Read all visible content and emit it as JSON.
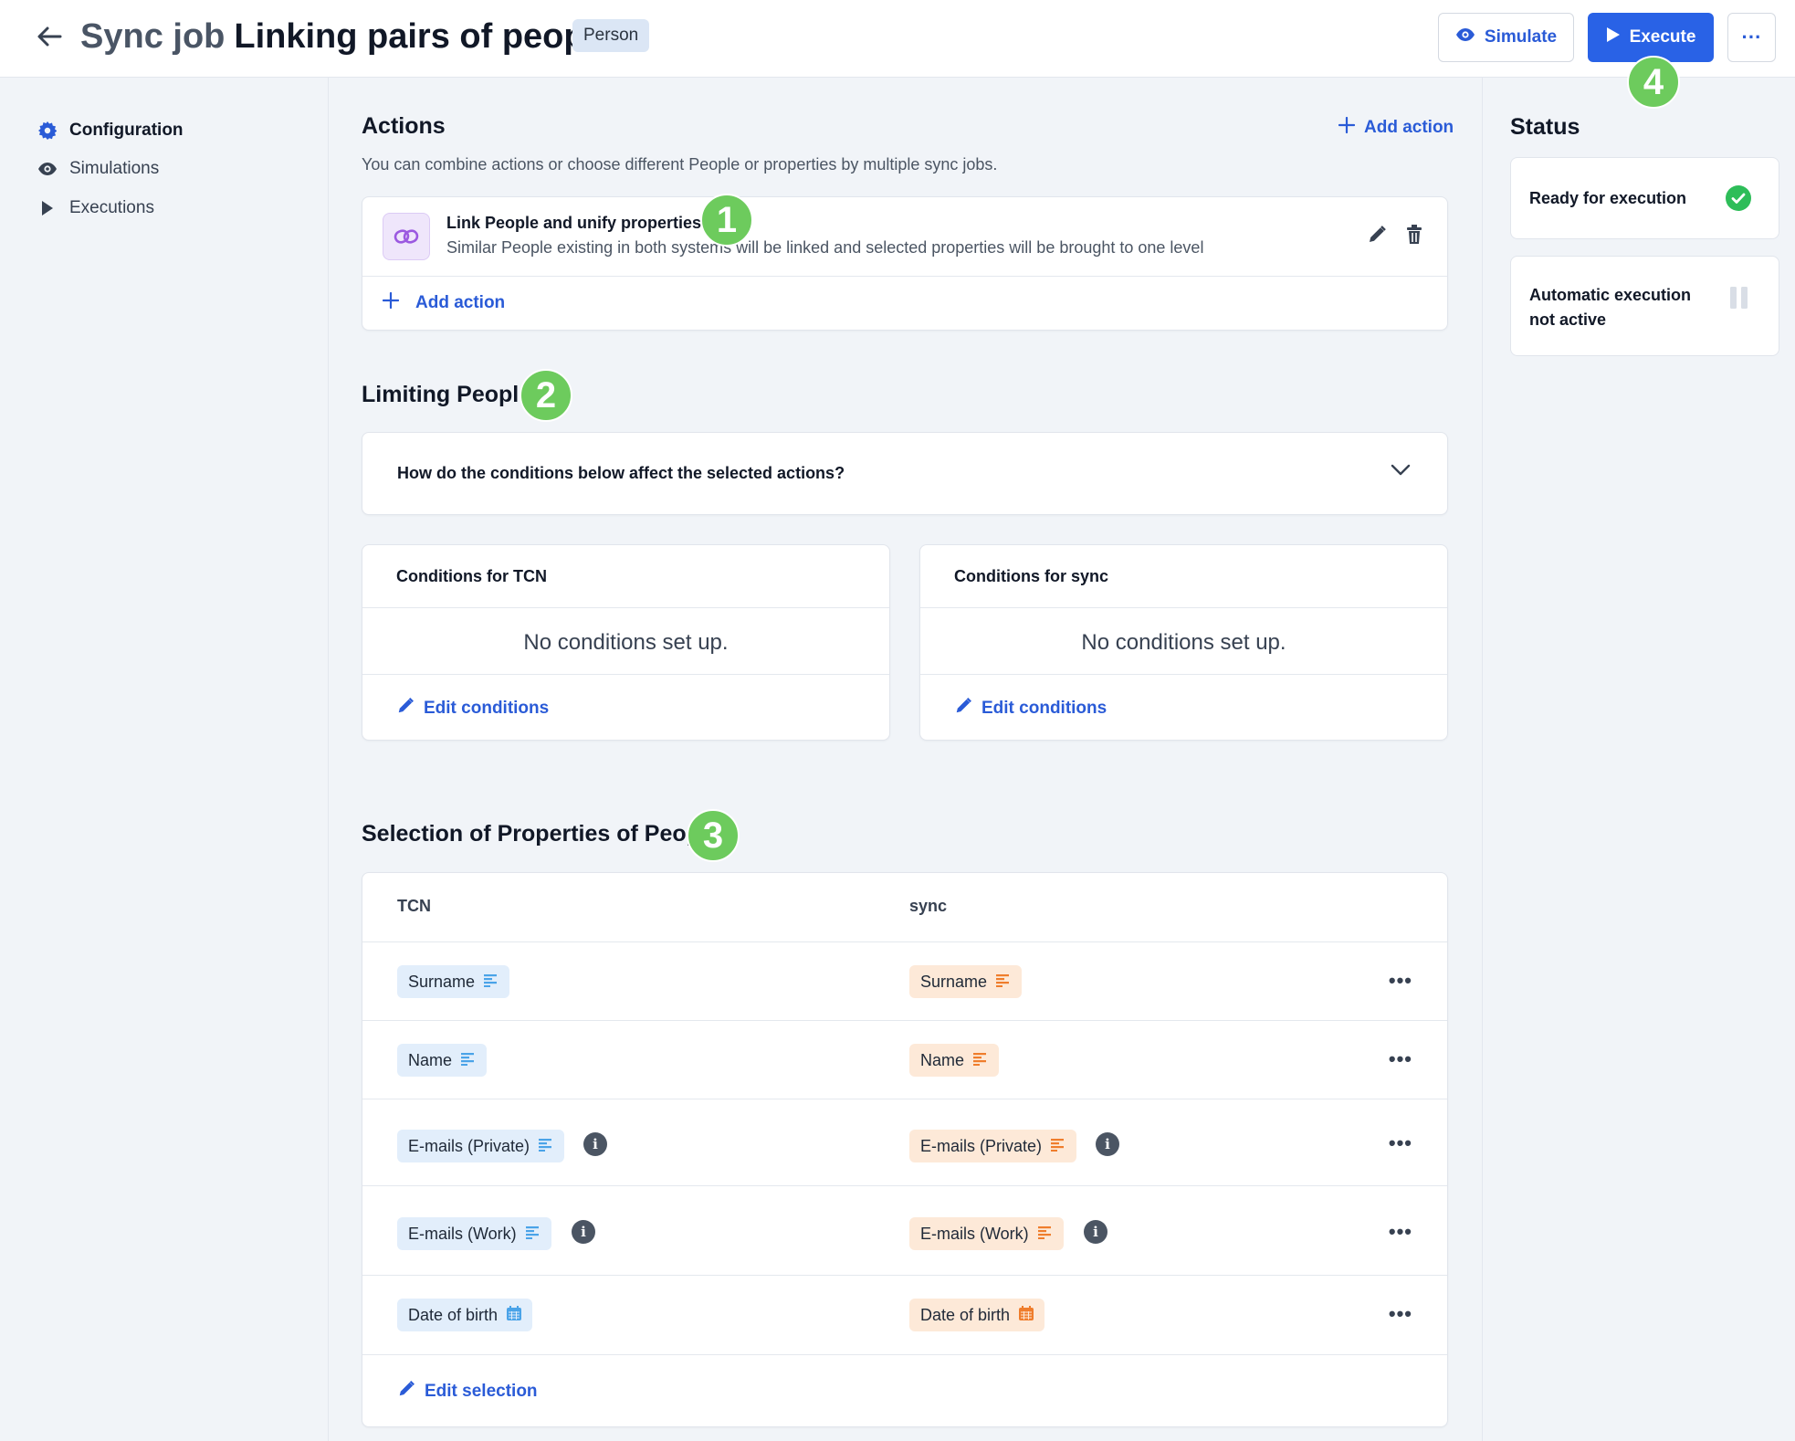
{
  "header": {
    "title_prefix": "Sync job",
    "title": "Linking pairs of people",
    "entity_badge": "Person",
    "simulate_label": "Simulate",
    "execute_label": "Execute",
    "more_label": "···"
  },
  "sidebar": {
    "items": [
      {
        "label": "Configuration",
        "icon": "gear-icon",
        "active": true
      },
      {
        "label": "Simulations",
        "icon": "eye-icon",
        "active": false
      },
      {
        "label": "Executions",
        "icon": "play-icon",
        "active": false
      }
    ]
  },
  "actions": {
    "heading": "Actions",
    "add_action_top": "Add action",
    "description": "You can combine actions or choose different People or properties by multiple sync jobs.",
    "item": {
      "title": "Link People and unify properties",
      "description": "Similar People existing in both systems will be linked and selected properties will be brought to one level",
      "icon": "link-icon"
    },
    "add_action_bottom": "Add action"
  },
  "limiting": {
    "heading": "Limiting People",
    "faq_question": "How do the conditions below affect the selected actions?",
    "tcn": {
      "title": "Conditions for TCN",
      "empty": "No conditions set up.",
      "edit": "Edit conditions"
    },
    "sync": {
      "title": "Conditions for sync",
      "empty": "No conditions set up.",
      "edit": "Edit conditions"
    }
  },
  "selection": {
    "heading": "Selection of Properties of People",
    "col_left": "TCN",
    "col_right": "sync",
    "rows": [
      {
        "left": "Surname",
        "right": "Surname",
        "type": "text",
        "info": false
      },
      {
        "left": "Name",
        "right": "Name",
        "type": "text",
        "info": false
      },
      {
        "left": "E-mails (Private)",
        "right": "E-mails (Private)",
        "type": "text",
        "info": true
      },
      {
        "left": "E-mails (Work)",
        "right": "E-mails (Work)",
        "type": "text",
        "info": true
      },
      {
        "left": "Date of birth",
        "right": "Date of birth",
        "type": "date",
        "info": false
      }
    ],
    "row_more": "•••",
    "edit_selection": "Edit selection"
  },
  "status": {
    "heading": "Status",
    "ready": "Ready for execution",
    "auto_line1": "Automatic execution",
    "auto_line2": "not active"
  },
  "markers": [
    "1",
    "2",
    "3",
    "4"
  ],
  "colors": {
    "accent": "#2962e6",
    "success": "#2ebd59",
    "marker": "#6dcb5d",
    "chip_blue": "#e2eefb",
    "chip_orange": "#fde9d8"
  }
}
